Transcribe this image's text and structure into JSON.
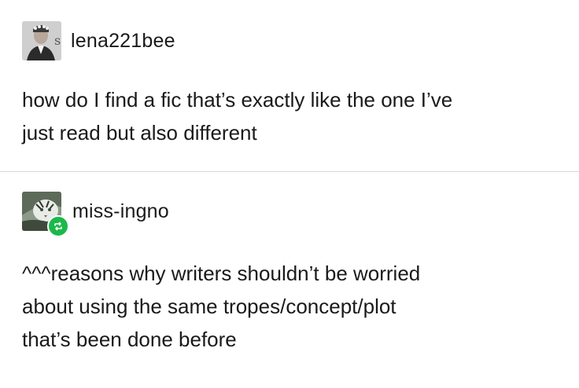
{
  "posts": [
    {
      "username": "lena221bee",
      "avatar_icon": "avatar-photo-icon",
      "text": "how do I find a fic that’s exactly like the one I’ve\njust read but also different"
    },
    {
      "username": "miss-ingno",
      "avatar_icon": "tiger-avatar-icon",
      "badge_icon": "reblog-icon",
      "badge_color": "#1cb84a",
      "text": "^^^reasons why writers shouldn’t be worried\nabout using the same tropes/concept/plot\nthat’s been done before"
    }
  ]
}
